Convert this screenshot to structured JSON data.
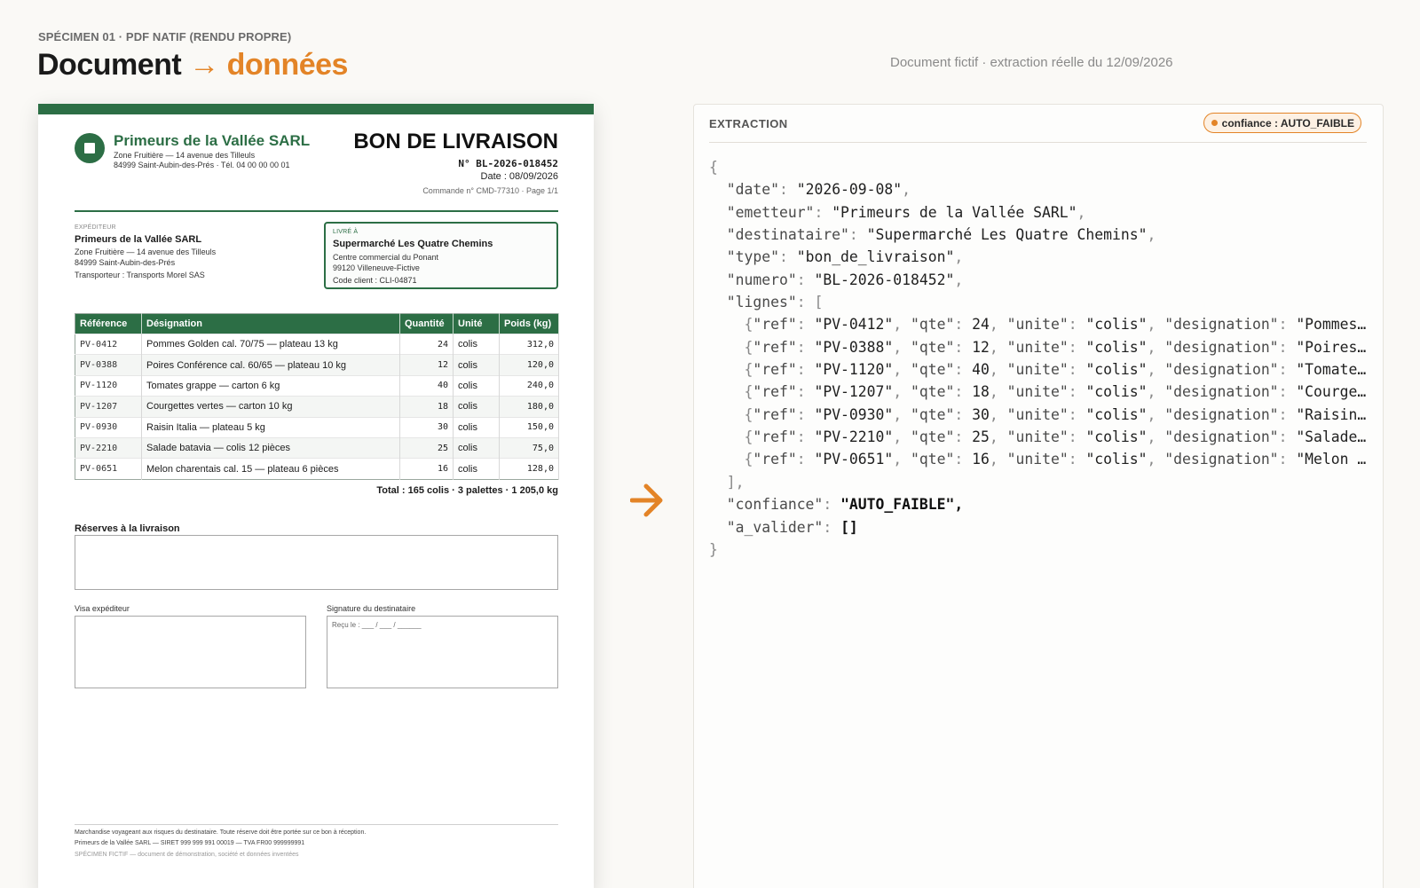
{
  "header": {
    "kicker": "SPÉCIMEN 01 · PDF NATIF (RENDU PROPRE)",
    "title_part1": "Document",
    "title_arrow": "→",
    "title_part2": "données",
    "note": "Document fictif · extraction réelle du 12/09/2026"
  },
  "colors": {
    "accent_orange": "#e38427",
    "brand_green": "#2c6e45"
  },
  "document": {
    "company": {
      "name": "Primeurs de la Vallée SARL",
      "address_line": "Zone Fruitière — 14 avenue des Tilleuls",
      "city_phone": "84999 Saint-Aubin-des-Prés   ·   Tél. 04 00 00 00 01"
    },
    "title": "BON DE LIVRAISON",
    "number": "N° BL-2026-018452",
    "date": "Date : 08/09/2026",
    "order_page": "Commande n° CMD-77310   ·   Page 1/1",
    "sender": {
      "label": "EXPÉDITEUR",
      "name": "Primeurs de la Vallée SARL",
      "address_line": "Zone Fruitière — 14 avenue des Tilleuls",
      "city": "84999 Saint-Aubin-des-Prés",
      "carrier": "Transporteur : Transports Morel SAS"
    },
    "recipient": {
      "label": "LIVRÉ À",
      "name": "Supermarché Les Quatre Chemins",
      "address_line": "Centre commercial du Ponant",
      "city": "99120 Villeneuve-Fictive",
      "client_code": "Code client : CLI-04871"
    },
    "table": {
      "headers": [
        "Référence",
        "Désignation",
        "Quantité",
        "Unité",
        "Poids (kg)"
      ],
      "rows": [
        [
          "PV-0412",
          "Pommes Golden cal. 70/75 — plateau 13 kg",
          "24",
          "colis",
          "312,0"
        ],
        [
          "PV-0388",
          "Poires Conférence cal. 60/65 — plateau 10 kg",
          "12",
          "colis",
          "120,0"
        ],
        [
          "PV-1120",
          "Tomates grappe — carton 6 kg",
          "40",
          "colis",
          "240,0"
        ],
        [
          "PV-1207",
          "Courgettes vertes — carton 10 kg",
          "18",
          "colis",
          "180,0"
        ],
        [
          "PV-0930",
          "Raisin Italia — plateau 5 kg",
          "30",
          "colis",
          "150,0"
        ],
        [
          "PV-2210",
          "Salade batavia — colis 12 pièces",
          "25",
          "colis",
          "75,0"
        ],
        [
          "PV-0651",
          "Melon charentais cal. 15 — plateau 6 pièces",
          "16",
          "colis",
          "128,0"
        ]
      ]
    },
    "totals": "Total : 165 colis   ·   3 palettes   ·   1 205,0 kg",
    "reserves_title": "Réserves à la livraison",
    "visa_label": "Visa expéditeur",
    "signature_label": "Signature du destinataire",
    "received_line": "Reçu le : ___ / ___ / ______",
    "footer": {
      "line1": "Marchandise voyageant aux risques du destinataire. Toute réserve doit être portée sur ce bon à réception.",
      "line2": "Primeurs de la Vallée SARL — SIRET 999 999 991 00019 — TVA FR00 999999991",
      "line3": "SPÉCIMEN FICTIF — document de démonstration, société et données inventées"
    }
  },
  "extraction": {
    "title": "EXTRACTION",
    "badge": "confiance : AUTO_FAIBLE",
    "json": {
      "date": "2026-09-08",
      "emetteur": "Primeurs de la Vallée SARL",
      "destinataire": "Supermarché Les Quatre Chemins",
      "type": "bon_de_livraison",
      "numero": "BL-2026-018452",
      "lignes": [
        {
          "ref": "PV-0412",
          "qte": 24,
          "unite": "colis",
          "designation": "Pommes…"
        },
        {
          "ref": "PV-0388",
          "qte": 12,
          "unite": "colis",
          "designation": "Poires…"
        },
        {
          "ref": "PV-1120",
          "qte": 40,
          "unite": "colis",
          "designation": "Tomate…"
        },
        {
          "ref": "PV-1207",
          "qte": 18,
          "unite": "colis",
          "designation": "Courge…"
        },
        {
          "ref": "PV-0930",
          "qte": 30,
          "unite": "colis",
          "designation": "Raisin…"
        },
        {
          "ref": "PV-2210",
          "qte": 25,
          "unite": "colis",
          "designation": "Salade…"
        },
        {
          "ref": "PV-0651",
          "qte": 16,
          "unite": "colis",
          "designation": "Melon …"
        }
      ],
      "confiance": "AUTO_FAIBLE",
      "a_valider": []
    }
  }
}
